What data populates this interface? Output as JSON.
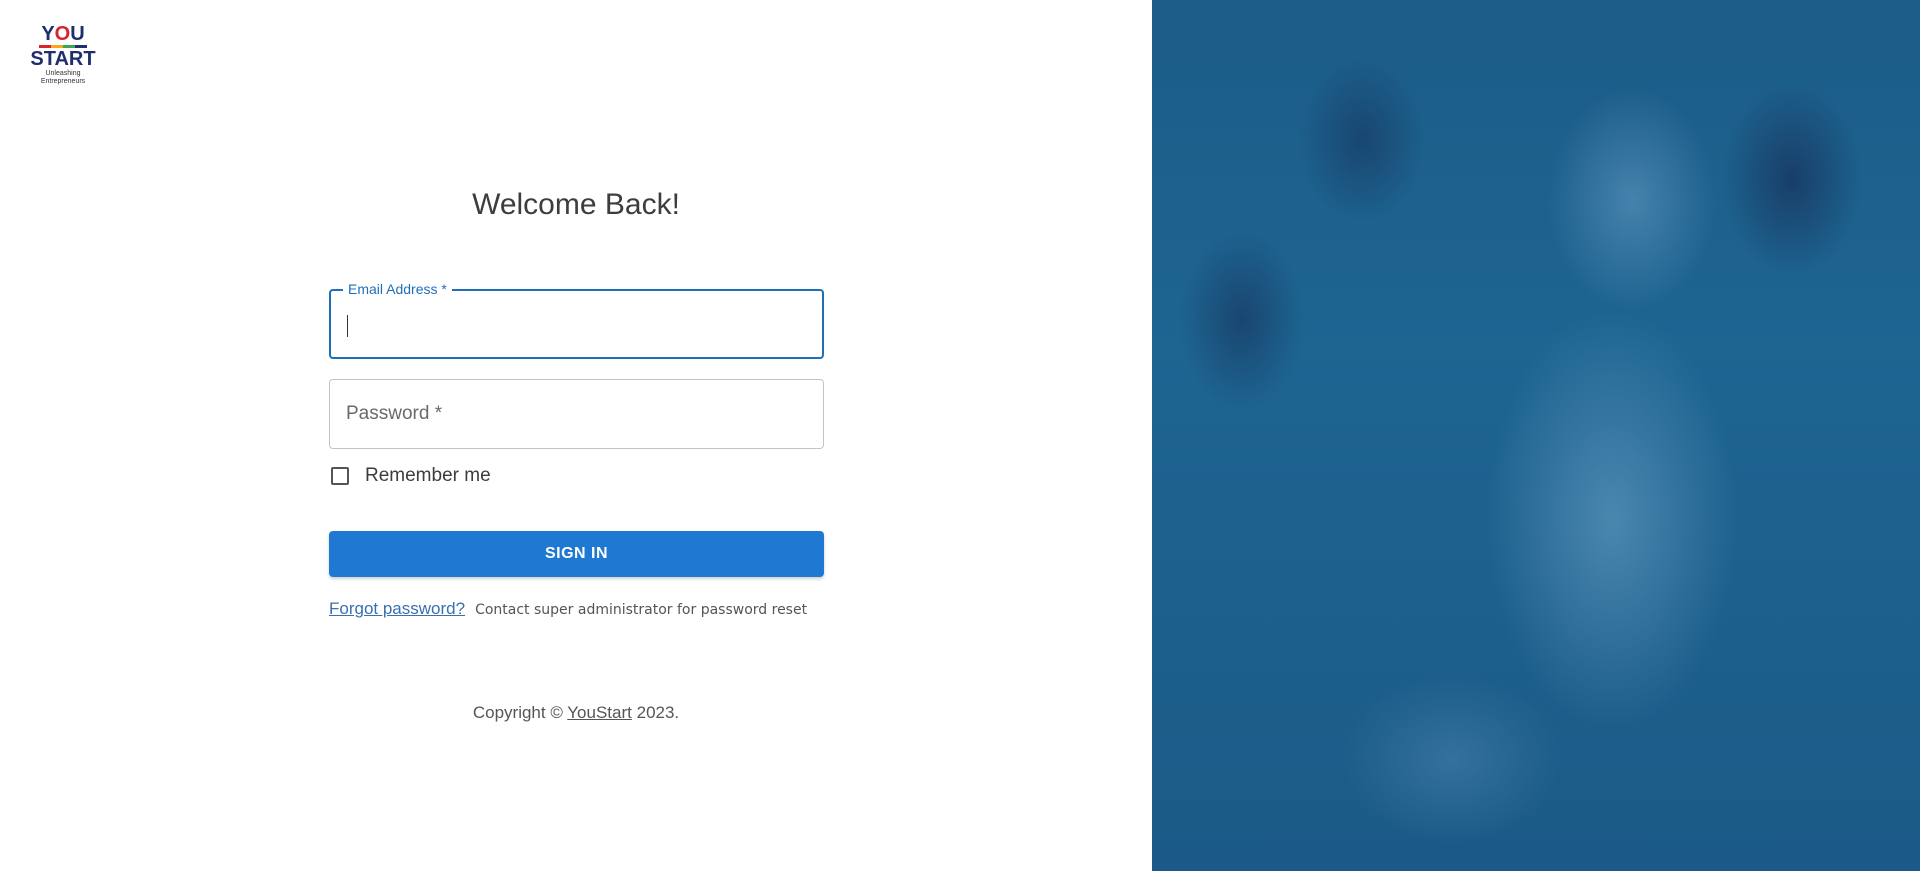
{
  "logo": {
    "line1_a": "Y",
    "line1_o": "O",
    "line1_b": "U",
    "line2": "START",
    "tagline1": "Unleashing",
    "tagline2": "Entrepreneurs"
  },
  "login": {
    "title": "Welcome Back!",
    "email_label": "Email Address *",
    "email_value": "",
    "password_placeholder": "Password *",
    "remember_label": "Remember me",
    "signin_label": "SIGN IN",
    "forgot_link": "Forgot password?",
    "forgot_note": "Contact super administrator for password reset"
  },
  "footer": {
    "prefix": "Copyright ©",
    "brand": "YouStart",
    "suffix": "2023."
  },
  "colors": {
    "accent": "#1f78d1",
    "focus_border": "#1f6fb8",
    "photo_tint": "#1d5f8c"
  }
}
